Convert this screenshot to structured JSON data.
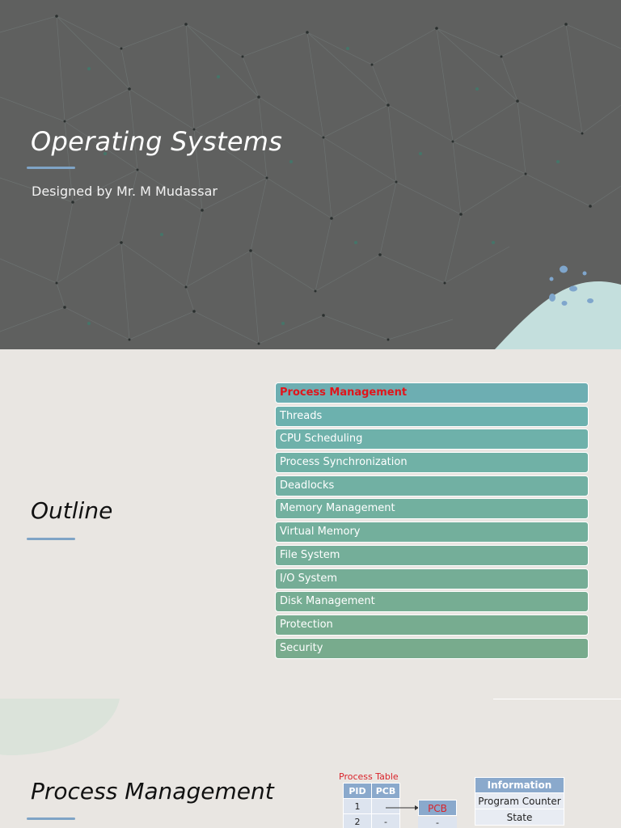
{
  "slides": [
    {
      "title": "Operating Systems",
      "subtitle": "Designed by Mr. M Mudassar"
    },
    {
      "title": "Outline",
      "items": [
        {
          "label": "Process Management",
          "active": true,
          "color": "#6daeb2"
        },
        {
          "label": "Threads",
          "active": false,
          "color": "#6cb1ae"
        },
        {
          "label": "CPU Scheduling",
          "active": false,
          "color": "#6eb1aa"
        },
        {
          "label": "Process Synchronization",
          "active": false,
          "color": "#70b1a6"
        },
        {
          "label": "Deadlocks",
          "active": false,
          "color": "#71b0a3"
        },
        {
          "label": "Memory Management",
          "active": false,
          "color": "#72b09f"
        },
        {
          "label": "Virtual Memory",
          "active": false,
          "color": "#73af9c"
        },
        {
          "label": "File System",
          "active": false,
          "color": "#74ae99"
        },
        {
          "label": "I/O System",
          "active": false,
          "color": "#75ad96"
        },
        {
          "label": "Disk Management",
          "active": false,
          "color": "#76ad93"
        },
        {
          "label": "Protection",
          "active": false,
          "color": "#77ac90"
        },
        {
          "label": "Security",
          "active": false,
          "color": "#78ab8d"
        }
      ]
    },
    {
      "title": "Process Management",
      "process_table": {
        "caption": "Process Table",
        "headers": [
          "PID",
          "PCB"
        ],
        "rows": [
          [
            "1",
            ""
          ],
          [
            "2",
            "-"
          ]
        ]
      },
      "pcb": {
        "label": "PCB",
        "sub": "-"
      },
      "info_table": {
        "header": "Information",
        "rows": [
          "Program Counter",
          "State"
        ]
      }
    }
  ],
  "colors": {
    "accent_underline": "#7fa4c6",
    "active_item_text": "#e0151b",
    "table_header": "#8aa9cc"
  }
}
